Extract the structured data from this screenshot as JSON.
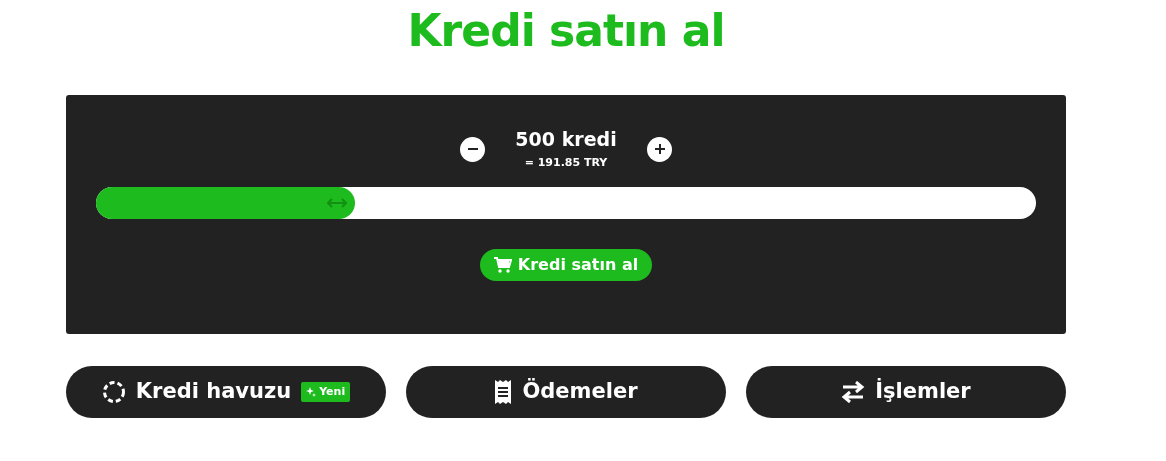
{
  "title": "Kredi satın al",
  "amount": {
    "value": "500 kredi",
    "price": "= 191.85 TRY",
    "level": 0.275
  },
  "buy_button": {
    "label": "Kredi satın al"
  },
  "links": [
    {
      "kind": "pool",
      "label": "Kredi havuzu",
      "badge": "Yeni"
    },
    {
      "kind": "payments",
      "label": "Ödemeler"
    },
    {
      "kind": "transactions",
      "label": "İşlemler"
    }
  ]
}
